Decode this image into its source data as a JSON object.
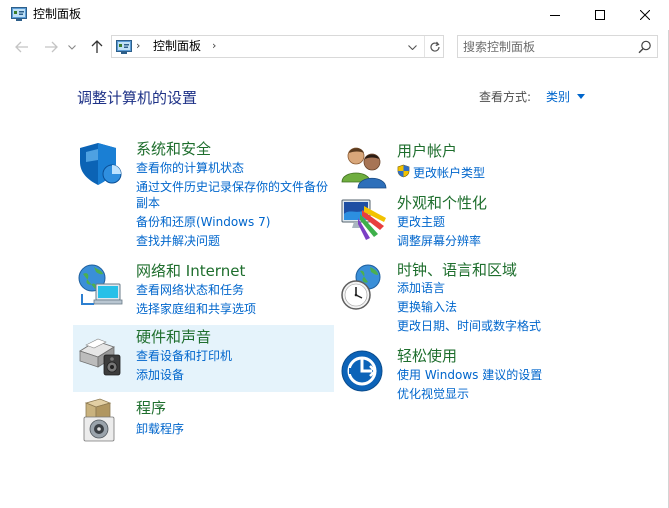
{
  "window": {
    "title": "控制面板"
  },
  "address": {
    "path": "控制面板",
    "separator": "›"
  },
  "search": {
    "placeholder": "搜索控制面板"
  },
  "page": {
    "heading": "调整计算机的设置",
    "view_by_label": "查看方式:",
    "view_by_value": "类别"
  },
  "categories": {
    "system_security": {
      "title": "系统和安全",
      "links": [
        "查看你的计算机状态",
        "通过文件历史记录保存你的文件备份",
        "副本",
        "备份和还原(Windows 7)",
        "查找并解决问题"
      ]
    },
    "network": {
      "title": "网络和 Internet",
      "links": [
        "查看网络状态和任务",
        "选择家庭组和共享选项"
      ]
    },
    "hardware": {
      "title": "硬件和声音",
      "links": [
        "查看设备和打印机",
        "添加设备"
      ]
    },
    "programs": {
      "title": "程序",
      "links": [
        "卸载程序"
      ]
    },
    "user_accounts": {
      "title": "用户帐户",
      "links": [
        "更改帐户类型"
      ]
    },
    "appearance": {
      "title": "外观和个性化",
      "links": [
        "更改主题",
        "调整屏幕分辨率"
      ]
    },
    "clock_region": {
      "title": "时钟、语言和区域",
      "links": [
        "添加语言",
        "更换输入法",
        "更改日期、时间或数字格式"
      ]
    },
    "ease": {
      "title": "轻松使用",
      "links": [
        "使用 Windows 建议的设置",
        "优化视觉显示"
      ]
    }
  },
  "colors": {
    "category_title": "#1e6e2d",
    "link": "#0066cc",
    "heading": "#1e3287",
    "hover_bg": "#e5f3fb"
  }
}
